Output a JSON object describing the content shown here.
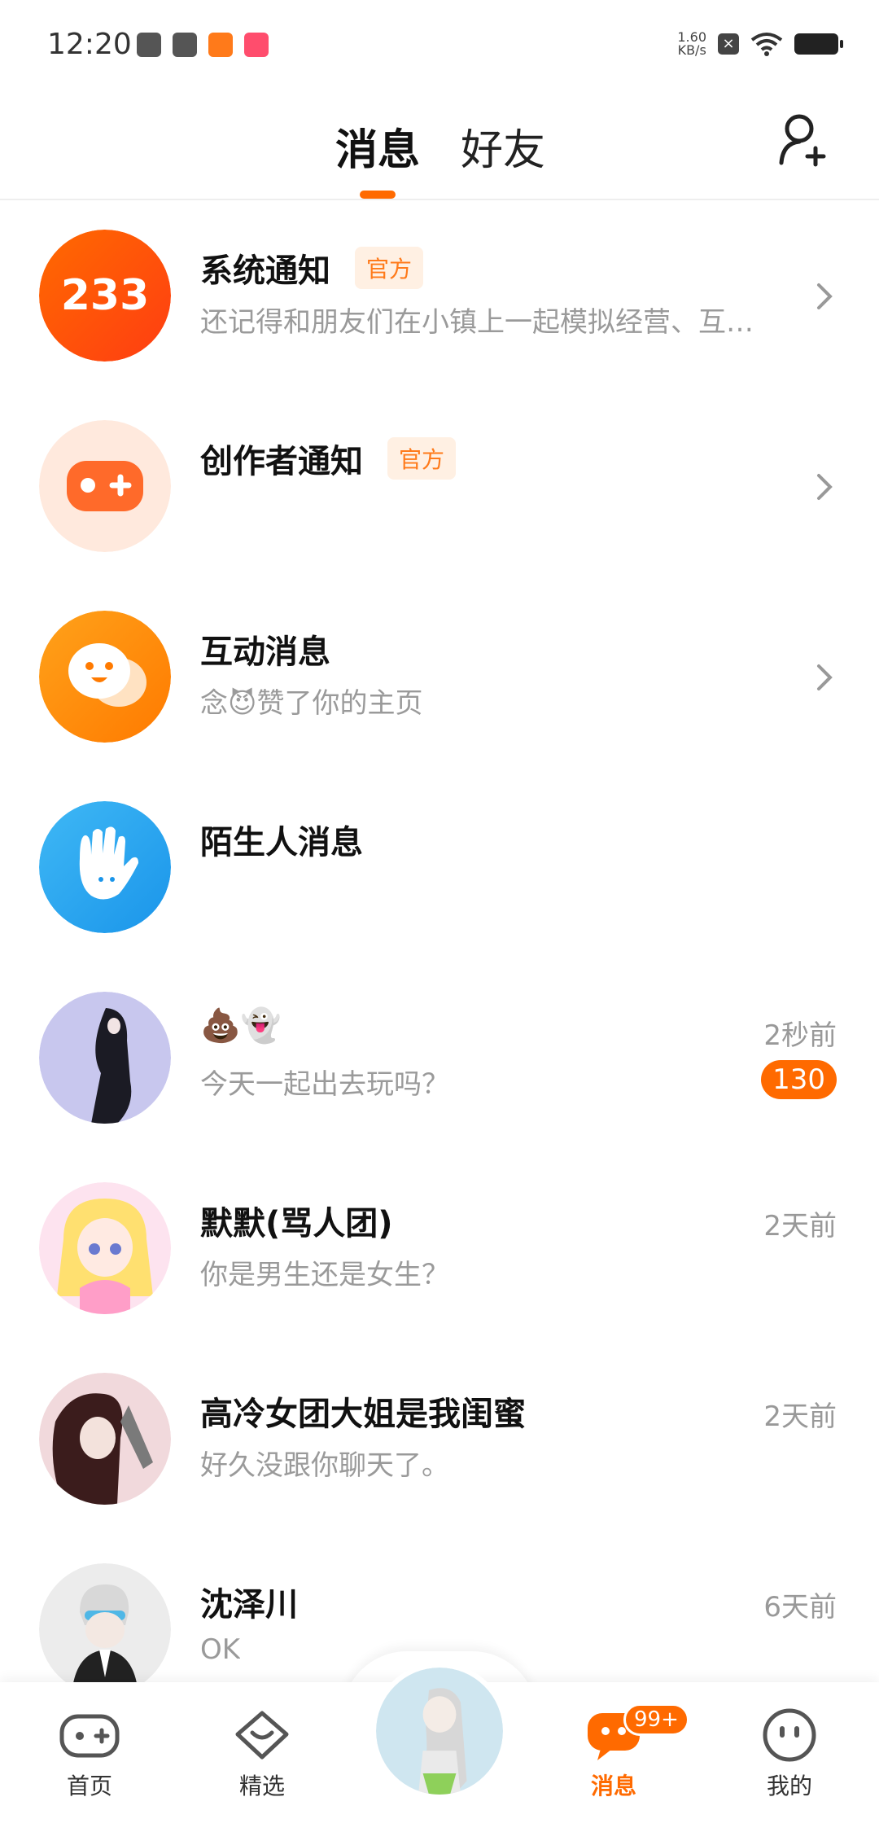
{
  "status_bar": {
    "time": "12:20",
    "net_speed_value": "1.60",
    "net_speed_unit": "KB/s"
  },
  "header": {
    "tab_messages": "消息",
    "tab_friends": "好友",
    "add_friend_icon": "add-user-icon"
  },
  "messages": [
    {
      "title": "系统通知",
      "badge": "官方",
      "subtitle": "还记得和朋友们在小镇上一起模拟经营、互…",
      "avatar_text": "233"
    },
    {
      "title": "创作者通知",
      "badge": "官方",
      "subtitle": ""
    },
    {
      "title": "互动消息",
      "badge": "",
      "subtitle": "念😈赞了你的主页"
    },
    {
      "title": "陌生人消息",
      "badge": "",
      "subtitle": ""
    },
    {
      "title": "💩👻",
      "subtitle": "今天一起出去玩吗？",
      "time": "2秒前",
      "unread": "130"
    },
    {
      "title": "默默(骂人团)",
      "subtitle": "你是男生还是女生？",
      "time": "2天前"
    },
    {
      "title": "高冷女团大姐是我闺蜜",
      "subtitle": "好久没跟你聊天了。",
      "time": "2天前"
    },
    {
      "title": "沈泽川",
      "subtitle": "OK",
      "time": "6天前"
    }
  ],
  "bottom_nav": {
    "home": "首页",
    "featured": "精选",
    "messages": "消息",
    "messages_badge": "99+",
    "mine": "我的"
  },
  "colors": {
    "accent": "#ff6a00",
    "official_badge_bg": "#fff0e3",
    "subtitle": "#9a9a9a"
  }
}
